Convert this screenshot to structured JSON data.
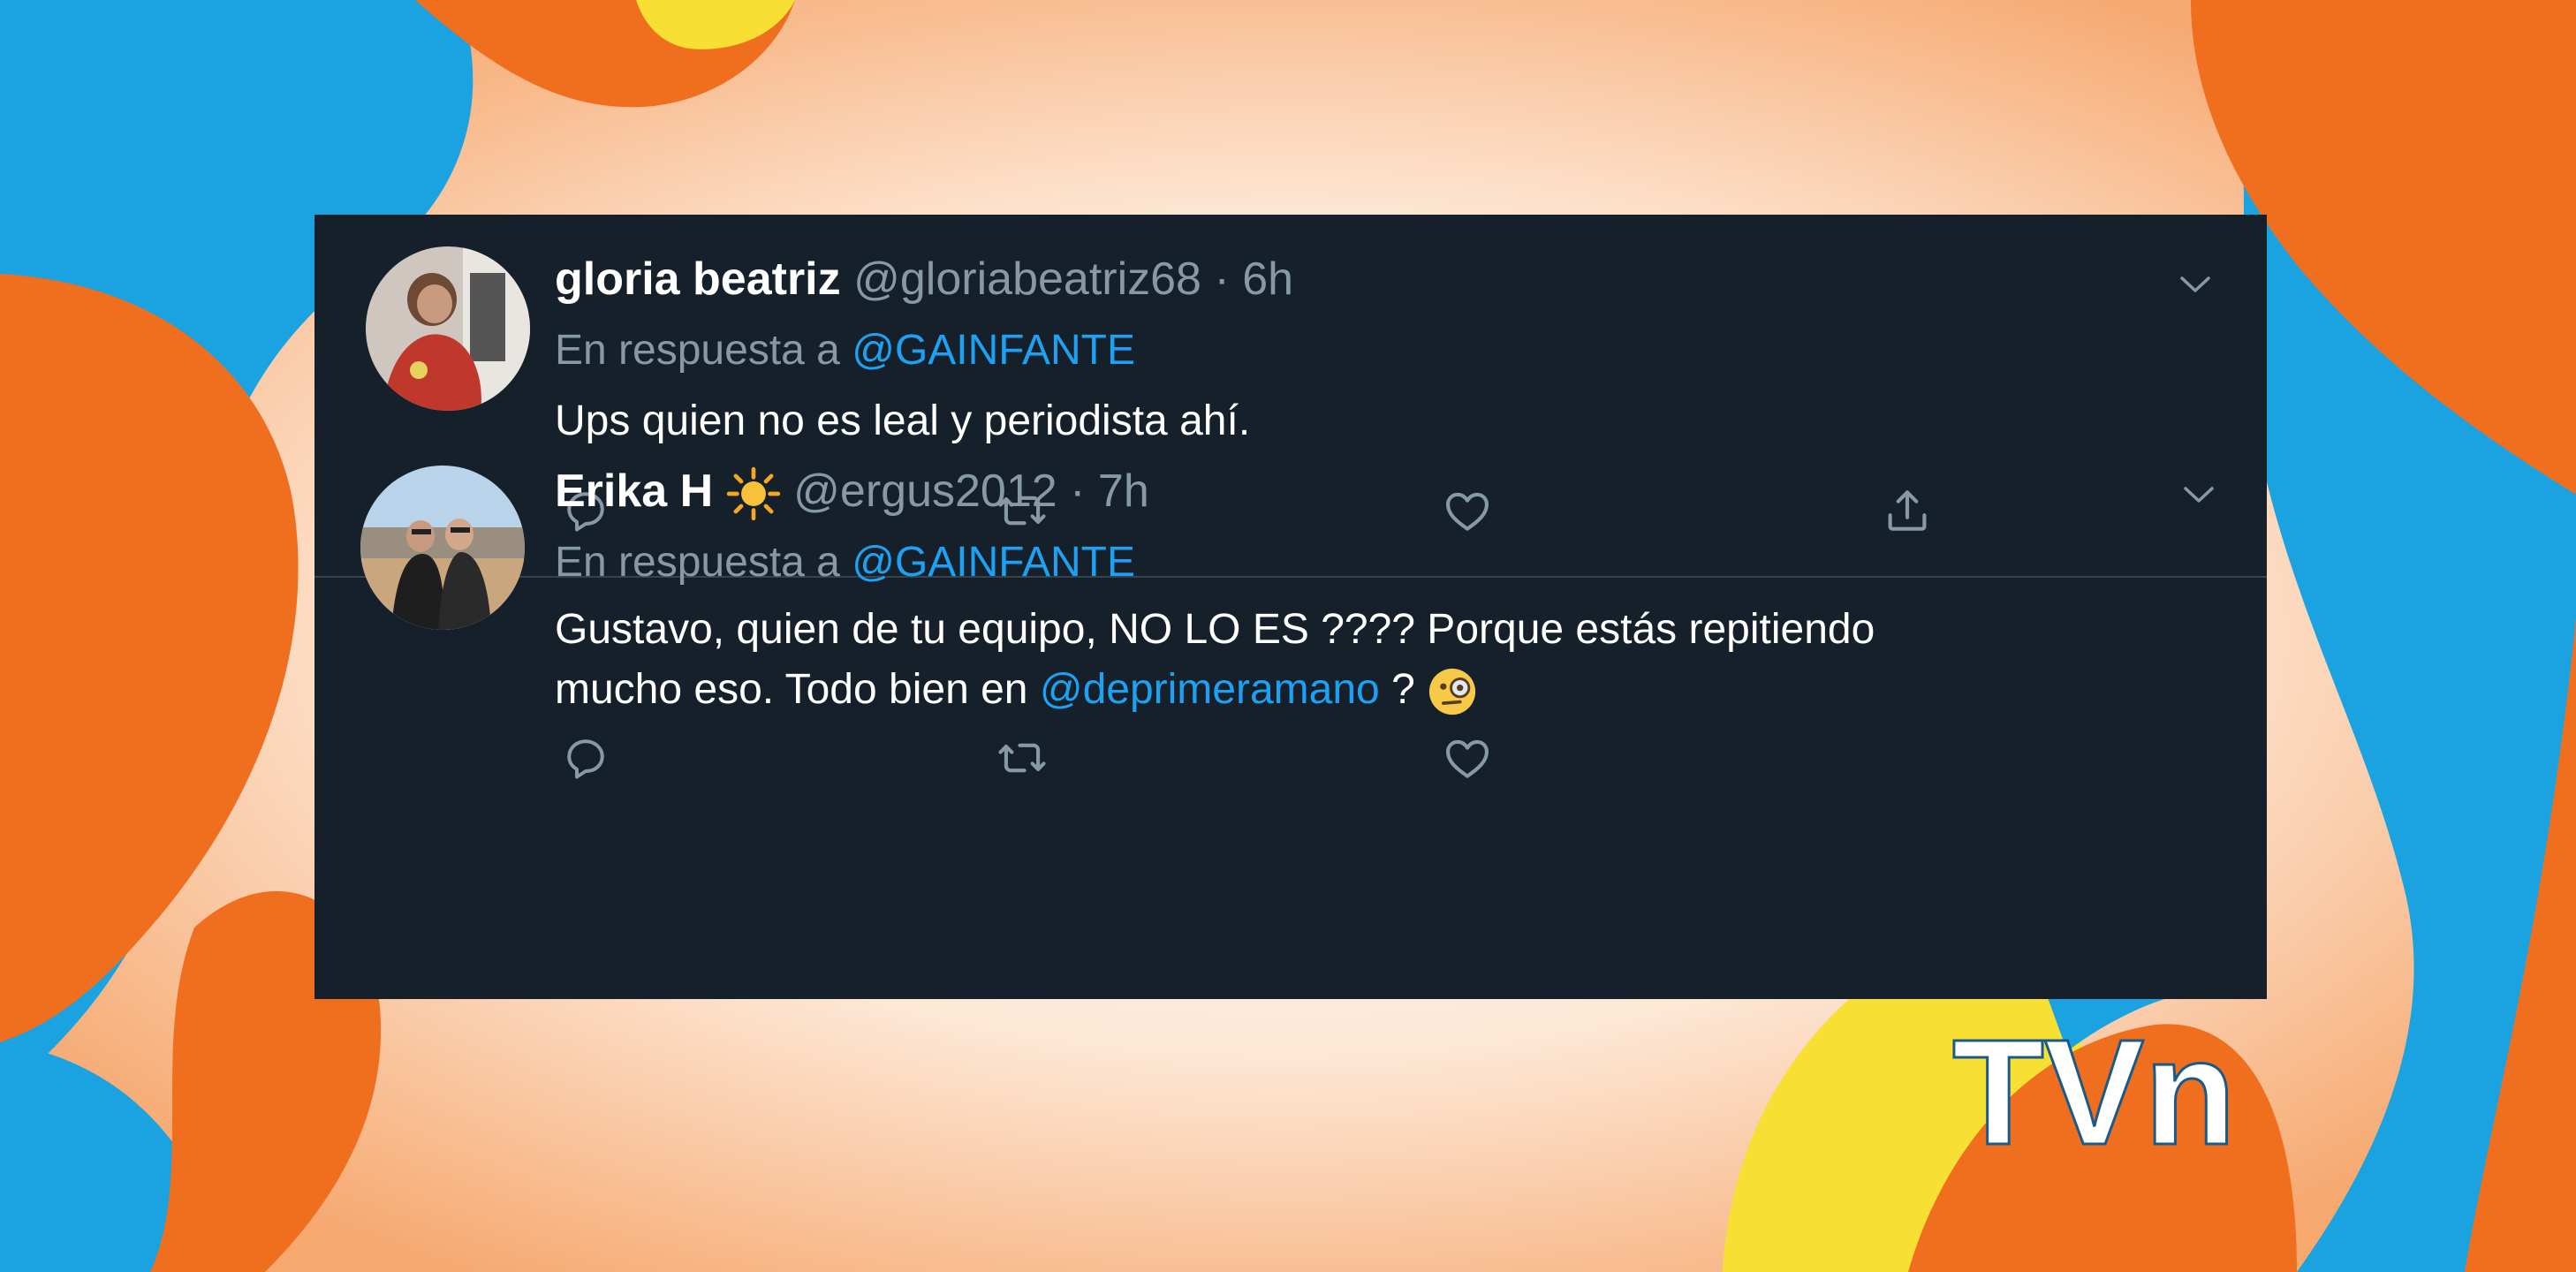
{
  "tweets": [
    {
      "name": "gloria beatriz",
      "handle": "@gloriabeatriz68",
      "separator": "·",
      "time": "6h",
      "reply_prefix": "En respuesta a",
      "reply_to": "@GAINFANTE",
      "text": "Ups quien no es leal y periodista ahí."
    },
    {
      "name": "Erika H",
      "name_emoji": "sun-emoji",
      "handle": "@ergus2012",
      "separator": "·",
      "time": "7h",
      "reply_prefix": "En respuesta a",
      "reply_to": "@GAINFANTE",
      "text_line1": "Gustavo, quien de tu equipo, NO LO ES ???? Porque estás repitiendo",
      "text_line2_pre": "mucho eso. Todo bien en",
      "text_line2_mention": "@deprimeramano",
      "text_line2_post": "?",
      "text_emoji": "monocle-face-emoji"
    }
  ],
  "actions": [
    "reply-icon",
    "retweet-icon",
    "like-icon",
    "share-icon"
  ],
  "logo": {
    "text": "TVn"
  },
  "colors": {
    "card_bg": "#15202b",
    "divider": "#38444d",
    "secondary_text": "#8899a6",
    "link": "#1da1f2",
    "bg_blue": "#1aa3e0",
    "bg_orange": "#ef6f1f",
    "bg_yellow": "#f7e033"
  }
}
